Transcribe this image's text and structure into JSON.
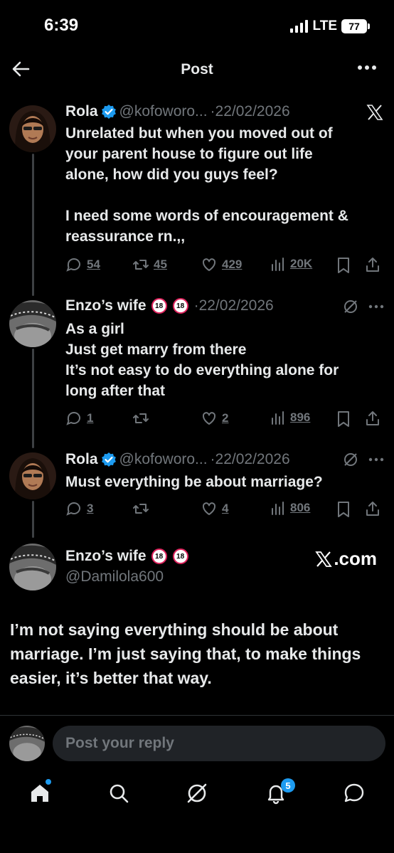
{
  "status_bar": {
    "time": "6:39",
    "network": "LTE",
    "battery": "77"
  },
  "header": {
    "title": "Post"
  },
  "thread": [
    {
      "name": "Rola",
      "handle": "@kofoworo...",
      "date": "·22/02/2026",
      "text": "Unrelated but when you moved out of\nyour parent house to figure out life\nalone, how did you guys feel?\n\nI need some words of encouragement &\nreassurance rn.,,",
      "replies": "54",
      "reposts": "45",
      "likes": "429",
      "views": "20K"
    },
    {
      "name": "Enzo’s wife",
      "badges": [
        "18",
        "18"
      ],
      "date": "·22/02/2026",
      "text": "As a girl\nJust get marry from there\nIt’s not easy to do everything alone for\nlong after that",
      "replies": "1",
      "reposts": "",
      "likes": "2",
      "views": "896"
    },
    {
      "name": "Rola",
      "handle": "@kofoworo...",
      "date": "·22/02/2026",
      "text": "Must everything be about marriage?",
      "replies": "3",
      "reposts": "",
      "likes": "4",
      "views": "806"
    }
  ],
  "main_post": {
    "name": "Enzo’s wife",
    "badges": [
      "18",
      "18"
    ],
    "handle": "@Damilola600",
    "watermark": ".com",
    "text": "I’m not saying everything should be about marriage. I’m just saying that, to make things easier, it’s better that way."
  },
  "reply_bar": {
    "placeholder": "Post your reply"
  },
  "bottom_nav": {
    "notifications_count": "5"
  },
  "colors": {
    "background": "#000000",
    "text": "#e7e9ea",
    "muted": "#71767b",
    "accent": "#1d9bf0",
    "badge_border": "#e0245e"
  }
}
